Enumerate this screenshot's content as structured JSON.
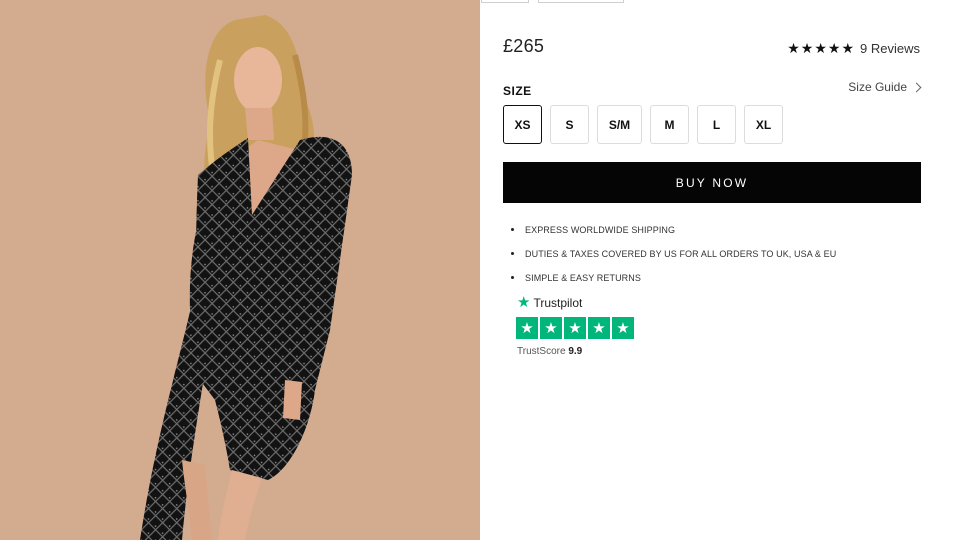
{
  "product": {
    "price": "£265",
    "rating_stars": [
      "★",
      "★",
      "★",
      "★",
      "★"
    ],
    "rating_value": 5,
    "reviews_label": "9 Reviews"
  },
  "size": {
    "label": "SIZE",
    "guide_label": "Size Guide",
    "options": [
      "XS",
      "S",
      "S/M",
      "M",
      "L",
      "XL"
    ],
    "selected": "XS"
  },
  "buy_button": {
    "label": "BUY NOW"
  },
  "perks": [
    "EXPRESS WORLDWIDE SHIPPING",
    "DUTIES & TAXES COVERED BY US FOR ALL ORDERS TO UK, USA & EU",
    "SIMPLE & EASY RETURNS"
  ],
  "trustpilot": {
    "brand": "Trustpilot",
    "stars": [
      "★",
      "★",
      "★",
      "★",
      "★"
    ],
    "score_label": "TrustScore",
    "score_value": "9.9"
  },
  "colors": {
    "accent": "#050505",
    "trustpilot_green": "#00b67a",
    "photo_background": "#d3ac90"
  },
  "icons": {
    "star": "star-icon",
    "chevron": "chevron-right-icon",
    "trustpilot": "trustpilot-star-icon"
  }
}
